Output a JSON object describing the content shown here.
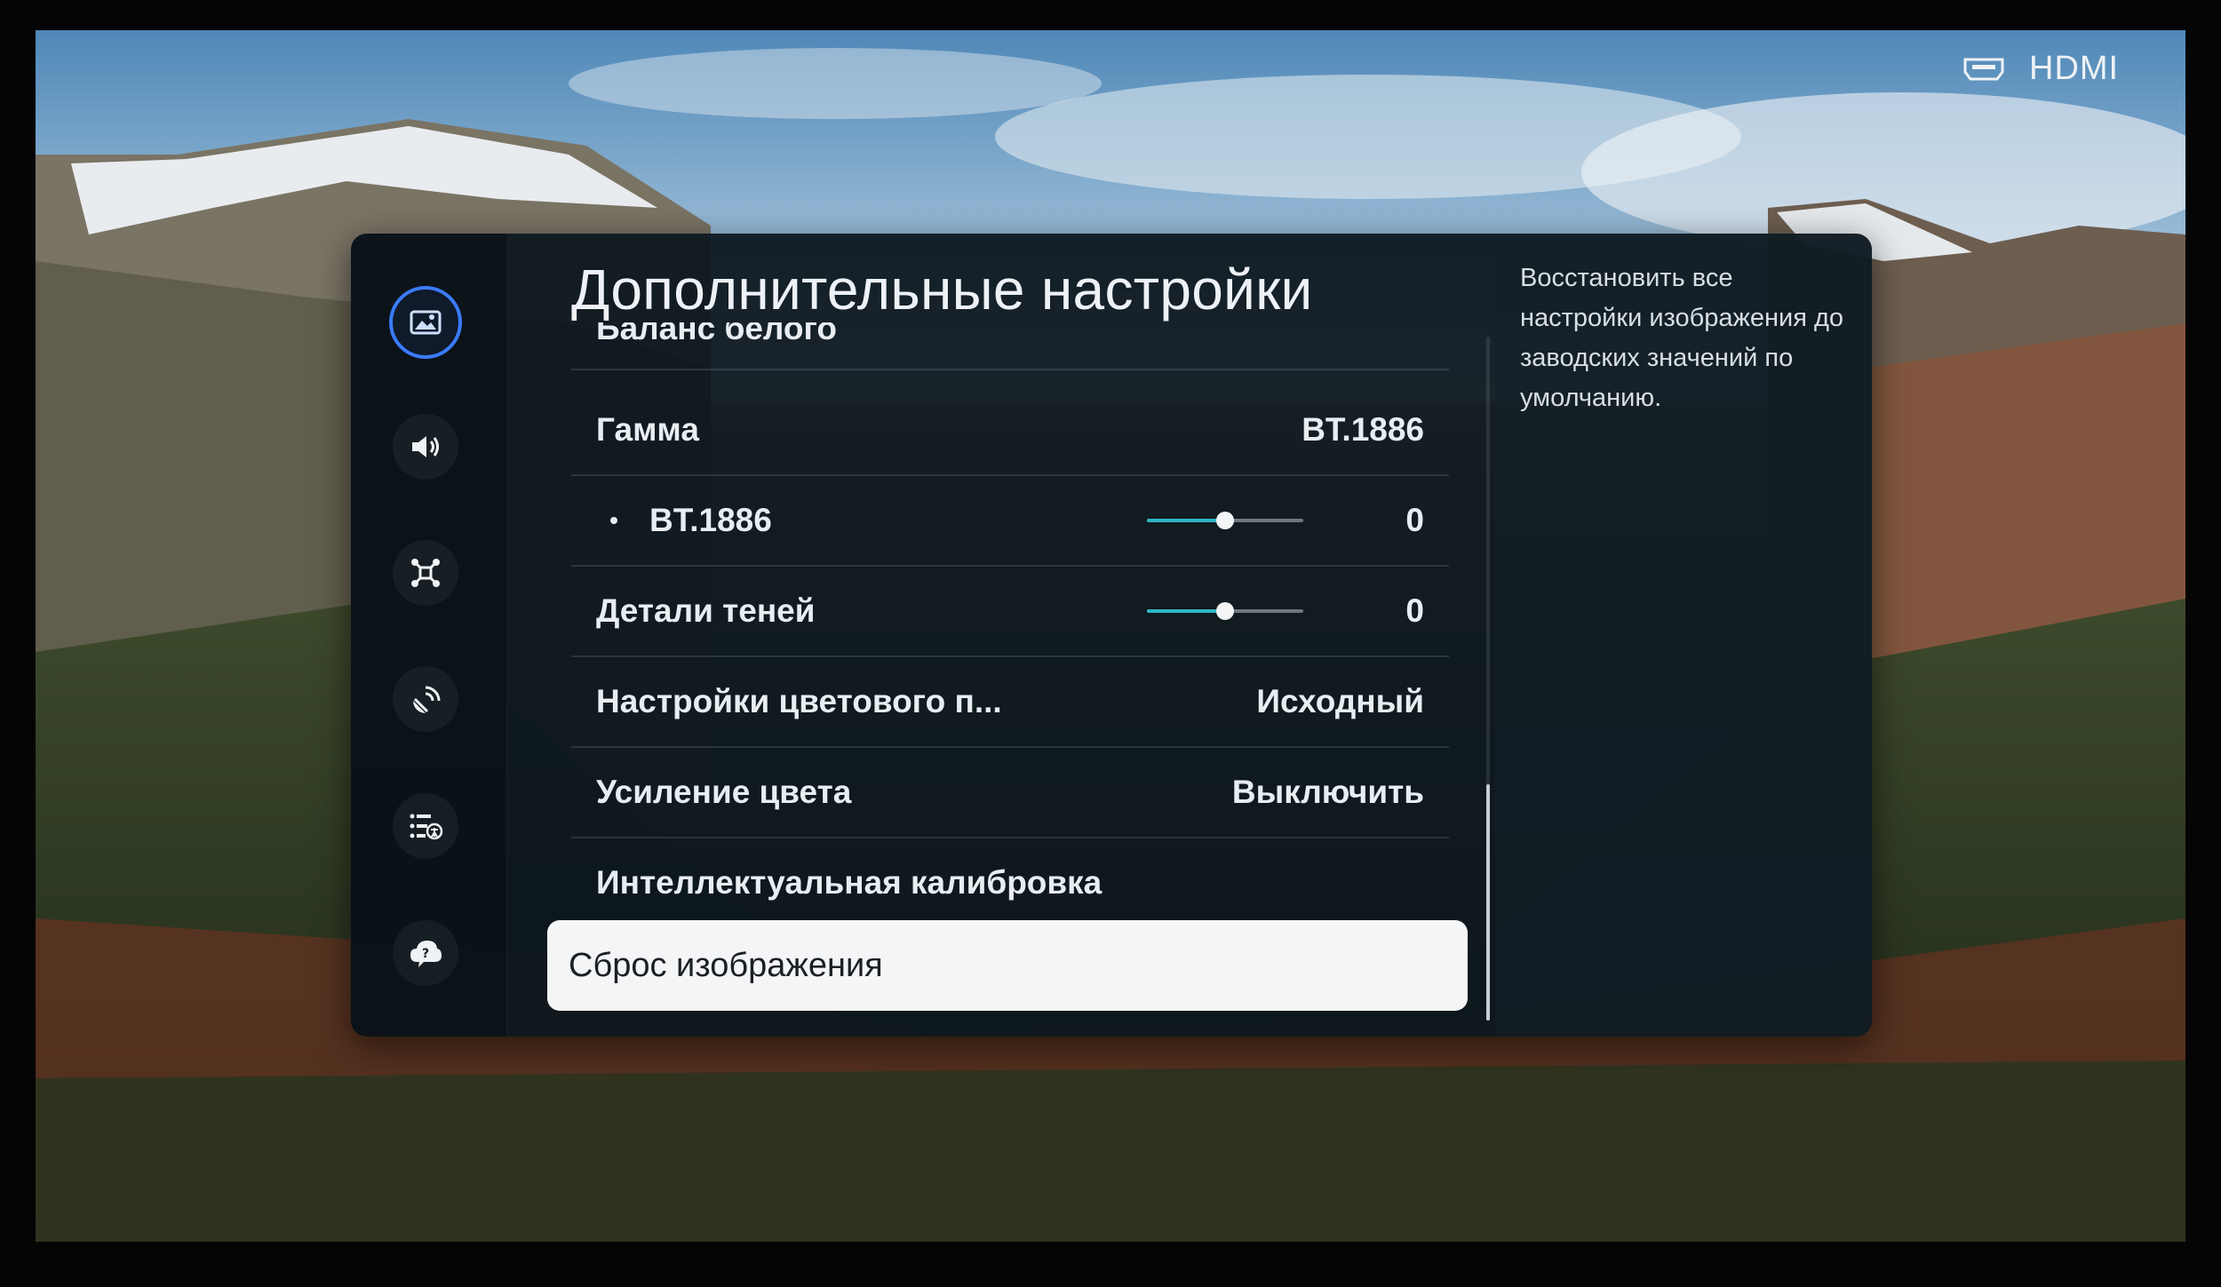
{
  "source": {
    "icon": "hdmi-port-icon",
    "label": "HDMI"
  },
  "side_nav": [
    {
      "icon": "picture-icon",
      "active": true
    },
    {
      "icon": "sound-icon",
      "active": false
    },
    {
      "icon": "connection-icon",
      "active": false
    },
    {
      "icon": "broadcast-icon",
      "active": false
    },
    {
      "icon": "general-icon",
      "active": false
    },
    {
      "icon": "support-icon",
      "active": false
    }
  ],
  "panel": {
    "title": "Дополнительные настройки",
    "partial_row": {
      "label": "Баланс белого"
    },
    "rows": [
      {
        "label": "Гамма",
        "value": "BT.1886"
      },
      {
        "label": "BT.1886",
        "value": "0",
        "slider": 0.5
      },
      {
        "label": "Детали теней",
        "value": "0",
        "slider": 0.5
      },
      {
        "label": "Настройки цветового п...",
        "value": "Исходный"
      },
      {
        "label": "Усиление цвета",
        "value": "Выключить"
      },
      {
        "label": "Интеллектуальная калибровка",
        "value": ""
      }
    ],
    "focused": {
      "label": "Сброс изображения"
    },
    "description": "Восстановить все настройки изображения до заводских значений по умолчанию."
  },
  "colors": {
    "accent": "#3b7bff",
    "slider_fill": "#2fb6c6",
    "panel_bg": "#0c161e"
  }
}
